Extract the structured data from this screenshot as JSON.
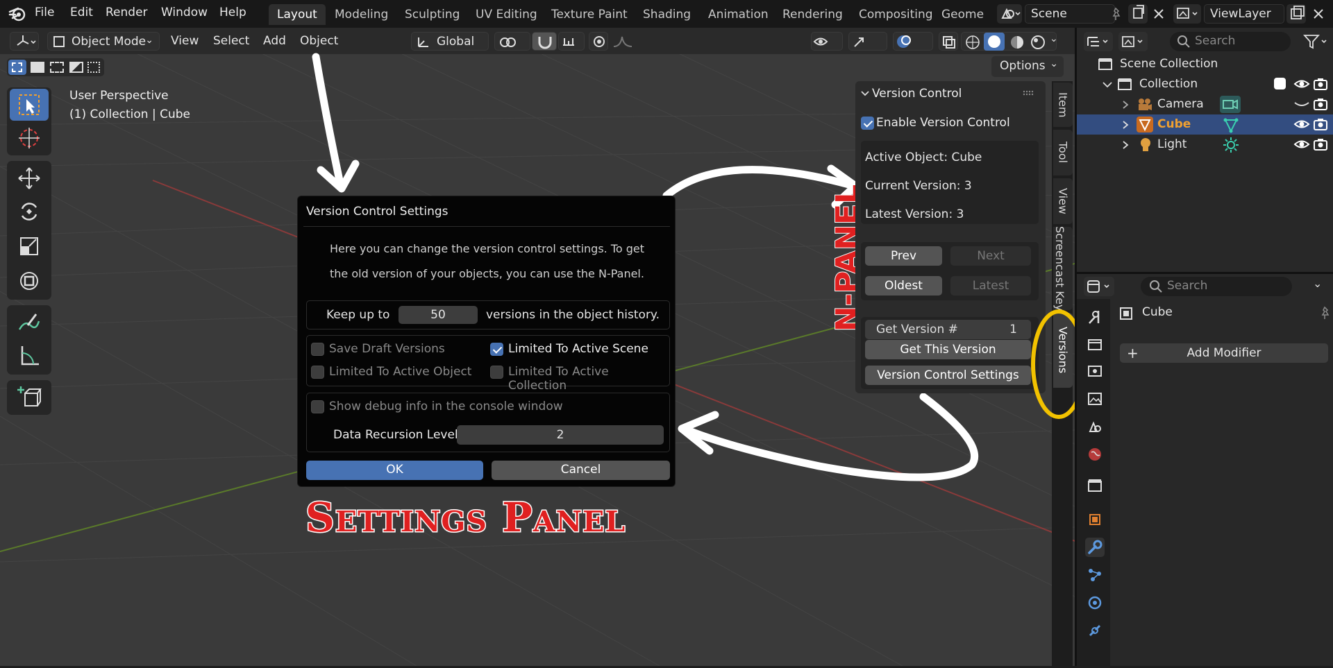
{
  "menubar": {
    "items": [
      "File",
      "Edit",
      "Render",
      "Window",
      "Help"
    ]
  },
  "workspaces": {
    "tabs": [
      "Layout",
      "Modeling",
      "Sculpting",
      "UV Editing",
      "Texture Paint",
      "Shading",
      "Animation",
      "Rendering",
      "Compositing",
      "Geome"
    ],
    "active": "Layout"
  },
  "scene": {
    "name": "Scene"
  },
  "viewlayer": {
    "name": "ViewLayer"
  },
  "viewport_header": {
    "mode": "Object Mode",
    "menus": [
      "View",
      "Select",
      "Add",
      "Object"
    ],
    "transform_orientation": "Global",
    "options_label": "Options"
  },
  "viewport": {
    "perspective_label": "User Perspective",
    "collection_label": "(1) Collection | Cube"
  },
  "dialog": {
    "title": "Version Control Settings",
    "description_line1": "Here you can change the version control settings. To get",
    "description_line2": "the old version of your objects, you can use the N-Panel.",
    "keep_prefix": "Keep up to",
    "keep_value": "50",
    "keep_suffix": "versions in the object history.",
    "save_draft": "Save Draft Versions",
    "limited_scene": "Limited To Active Scene",
    "limited_object": "Limited To Active Object",
    "limited_collection": "Limited To Active Collection",
    "debug_info": "Show debug info in the console window",
    "recursion_label": "Data Recursion Level",
    "recursion_value": "2",
    "ok_label": "OK",
    "cancel_label": "Cancel"
  },
  "npanel": {
    "title": "Version Control",
    "enable_label": "Enable Version Control",
    "active_object": "Active Object: Cube",
    "current_version": "Current Version: 3",
    "latest_version": "Latest Version: 3",
    "prev": "Prev",
    "next": "Next",
    "oldest": "Oldest",
    "latest": "Latest",
    "get_version_label": "Get Version #",
    "get_version_value": "1",
    "get_this_version": "Get This Version",
    "settings_button": "Version Control Settings"
  },
  "npanel_tabs": [
    "Item",
    "Tool",
    "View",
    "Screencast Keys",
    "Versions"
  ],
  "annotations": {
    "npanel_label": "N-PANEL",
    "settings_label": "Settings Panel"
  },
  "outliner": {
    "search_placeholder": "Search",
    "scene_collection": "Scene Collection",
    "collection": "Collection",
    "items": [
      {
        "name": "Camera",
        "color": "#8a8a8a"
      },
      {
        "name": "Cube",
        "color": "#f0a030"
      },
      {
        "name": "Light",
        "color": "#e6e6e6"
      }
    ]
  },
  "properties": {
    "search_placeholder": "Search",
    "object_name": "Cube",
    "add_modifier": "Add Modifier"
  },
  "colors": {
    "accent_blue": "#4772b3",
    "annotation_red": "#e02020",
    "highlight_yellow": "#f2c200"
  }
}
